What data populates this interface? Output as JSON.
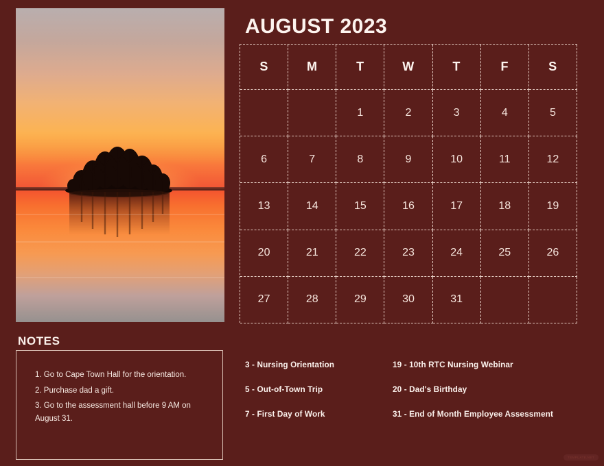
{
  "page": {
    "background_color": "#5a1e1b",
    "text_color": "#f6e8e1",
    "border_color": "#e5cdc4"
  },
  "photo": {
    "alt": "Sunset over a lake with a small island of bare trees and mirrored reflection",
    "caption": ""
  },
  "header": {
    "month_title": "AUGUST 2023"
  },
  "calendar": {
    "day_headers": [
      "S",
      "M",
      "T",
      "W",
      "T",
      "F",
      "S"
    ],
    "weeks": [
      [
        "",
        "",
        "1",
        "2",
        "3",
        "4",
        "5"
      ],
      [
        "6",
        "7",
        "8",
        "9",
        "10",
        "11",
        "12"
      ],
      [
        "13",
        "14",
        "15",
        "16",
        "17",
        "18",
        "19"
      ],
      [
        "20",
        "21",
        "22",
        "23",
        "24",
        "25",
        "26"
      ],
      [
        "27",
        "28",
        "29",
        "30",
        "31",
        "",
        ""
      ]
    ]
  },
  "notes": {
    "heading": "NOTES",
    "items": [
      "1. Go to Cape Town Hall for the orientation.",
      "2. Purchase dad a gift.",
      "3. Go to the assessment hall before 9 AM on August 31."
    ]
  },
  "events": {
    "left_column": [
      "3 - Nursing Orientation",
      "5 - Out-of-Town Trip",
      "7 - First Day of Work"
    ],
    "right_column": [
      "19 - 10th RTC Nursing Webinar",
      "20 - Dad's Birthday",
      "31 - End of Month Employee Assessment"
    ]
  },
  "watermark": {
    "label": "TEMPLATE.NET"
  }
}
